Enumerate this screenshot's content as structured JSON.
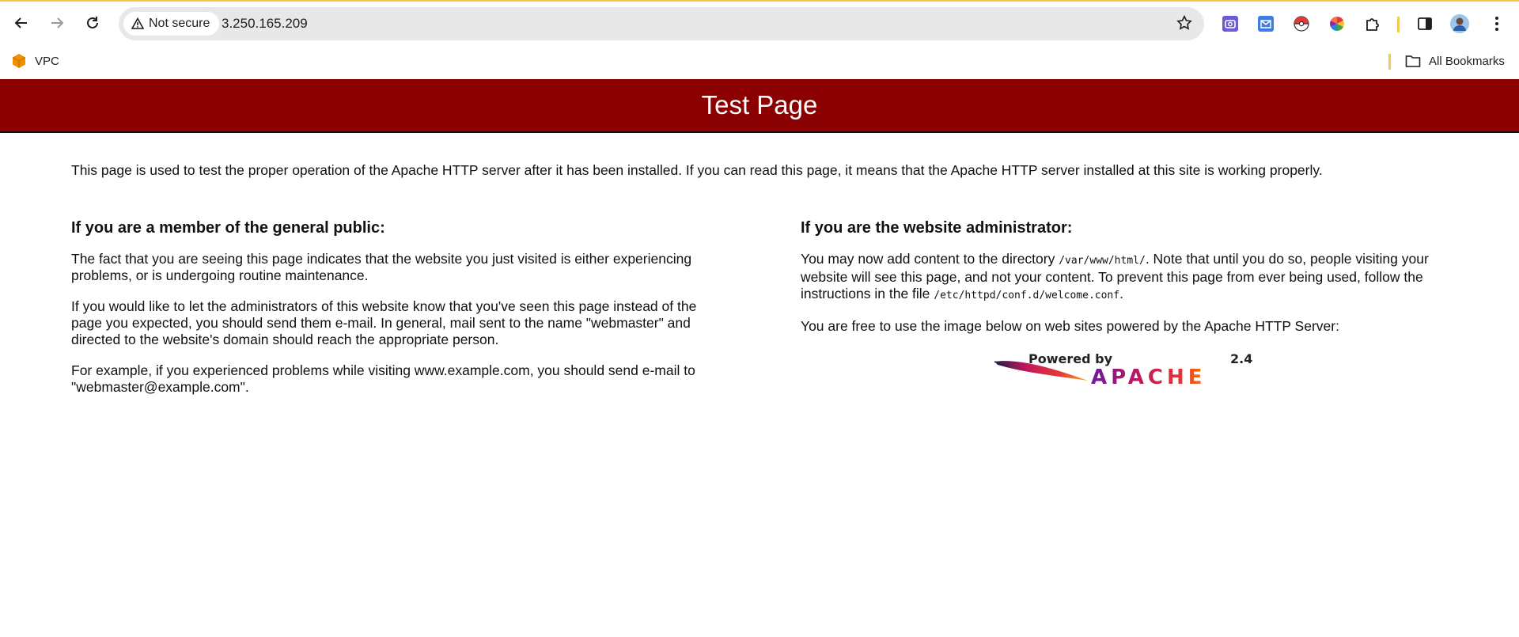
{
  "browser": {
    "security_label": "Not secure",
    "url": "3.250.165.209",
    "bookmarks": [
      {
        "label": "VPC"
      }
    ],
    "all_bookmarks_label": "All Bookmarks",
    "colors": {
      "accent_yellow": "#f2c94c"
    }
  },
  "page": {
    "title": "Test Page",
    "header_color": "#8b0000",
    "intro": "This page is used to test the proper operation of the Apache HTTP server after it has been installed. If you can read this page, it means that the Apache HTTP server installed at this site is working properly.",
    "public": {
      "heading": "If you are a member of the general public:",
      "p1": "The fact that you are seeing this page indicates that the website you just visited is either experiencing problems, or is undergoing routine maintenance.",
      "p2": "If you would like to let the administrators of this website know that you've seen this page instead of the page you expected, you should send them e-mail. In general, mail sent to the name \"webmaster\" and directed to the website's domain should reach the appropriate person.",
      "p3": "For example, if you experienced problems while visiting www.example.com, you should send e-mail to \"webmaster@example.com\"."
    },
    "admin": {
      "heading": "If you are the website administrator:",
      "p1_a": "You may now add content to the directory ",
      "p1_code1": "/var/www/html/",
      "p1_b": ". Note that until you do so, people visiting your website will see this page, and not your content. To prevent this page from ever being used, follow the instructions in the file ",
      "p1_code2": "/etc/httpd/conf.d/welcome.conf",
      "p1_c": ".",
      "p2": "You are free to use the image below on web sites powered by the Apache HTTP Server:"
    },
    "logo": {
      "powered_by": "Powered by",
      "version": "2.4",
      "wordmark": "APACHE"
    }
  }
}
